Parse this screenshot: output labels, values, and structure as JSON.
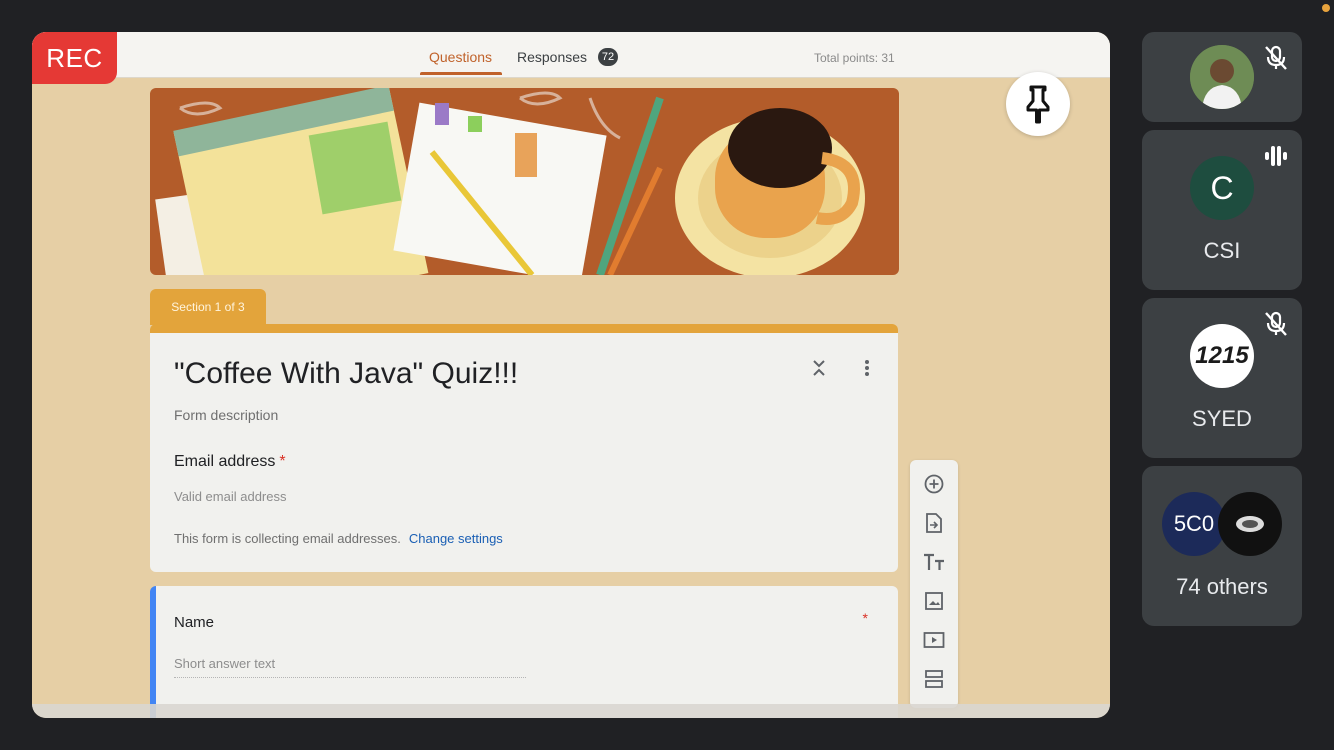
{
  "recording": {
    "label": "REC"
  },
  "forms": {
    "tabs": [
      {
        "label": "Questions",
        "active": true
      },
      {
        "label": "Responses",
        "count": "72"
      }
    ],
    "total_points": "Total points: 31",
    "section_label": "Section 1 of 3",
    "title": "\"Coffee With Java\" Quiz!!!",
    "description_placeholder": "Form description",
    "email": {
      "label": "Email address",
      "required_mark": "*",
      "placeholder": "Valid email address",
      "collecting_note": "This form is collecting email addresses.",
      "change_settings": "Change settings"
    },
    "questions": [
      {
        "label": "Name",
        "required_mark": "*",
        "placeholder": "Short answer text"
      }
    ],
    "toolbar": [
      "add-question-icon",
      "import-questions-icon",
      "add-title-icon",
      "add-image-icon",
      "add-video-icon",
      "add-section-icon"
    ]
  },
  "participants": [
    {
      "name": "",
      "mic": "muted",
      "avatar": "photo"
    },
    {
      "name": "CSI",
      "initial": "C",
      "mic": "speaking",
      "avatar_color": "#1e4d3f"
    },
    {
      "name": "SYED",
      "avatar_text": "1215",
      "mic": "muted"
    },
    {
      "name": "74 others",
      "avatar_text": "5C0"
    }
  ],
  "colors": {
    "accent": "#e3a43b",
    "rec": "#e53935",
    "link": "#1a5fb4",
    "tile": "#3c4043"
  }
}
